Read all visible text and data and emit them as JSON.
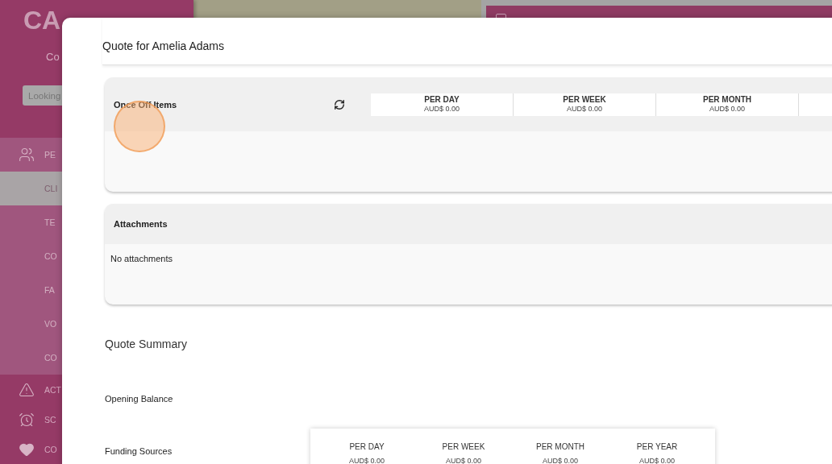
{
  "background": {
    "logo": "CA",
    "caption": "Co",
    "search": {
      "placeholder": "Looking"
    },
    "nav_items": [
      {
        "kind": "people",
        "label": "PE",
        "selected": false
      },
      {
        "kind": "sub",
        "label": "CLI",
        "selected": true
      },
      {
        "kind": "sub",
        "label": "TE",
        "selected": false
      },
      {
        "kind": "sub",
        "label": "CO",
        "selected": false
      },
      {
        "kind": "sub",
        "label": "FA",
        "selected": false
      },
      {
        "kind": "sub",
        "label": "VO",
        "selected": false
      },
      {
        "kind": "sub",
        "label": "CO",
        "selected": false
      },
      {
        "kind": "alert",
        "label": "ACT",
        "selected": false
      },
      {
        "kind": "schedule",
        "label": "SC",
        "selected": false
      },
      {
        "kind": "hearts",
        "label": "CO",
        "selected": false
      }
    ]
  },
  "modal": {
    "title": "Quote for Amelia Adams",
    "sections": [
      {
        "kind": "items",
        "title": "Once Off Items",
        "periods": [
          {
            "label": "PER DAY",
            "amount": "AUD$ 0.00"
          },
          {
            "label": "PER WEEK",
            "amount": "AUD$ 0.00"
          },
          {
            "label": "PER MONTH",
            "amount": "AUD$ 0.00"
          }
        ]
      },
      {
        "kind": "attachments",
        "title": "Attachments",
        "message": "No attachments"
      }
    ],
    "summary": {
      "title": "Quote Summary",
      "rows": [
        {
          "kind": "balance",
          "label": "Opening Balance"
        },
        {
          "kind": "funding",
          "label": "Funding Sources",
          "periods": [
            {
              "label": "PER DAY",
              "amount": "AUD$ 0.00"
            },
            {
              "label": "PER WEEK",
              "amount": "AUD$ 0.00"
            },
            {
              "label": "PER MONTH",
              "amount": "AUD$ 0.00"
            },
            {
              "label": "PER YEAR",
              "amount": "AUD$ 0.00"
            }
          ]
        }
      ]
    }
  }
}
